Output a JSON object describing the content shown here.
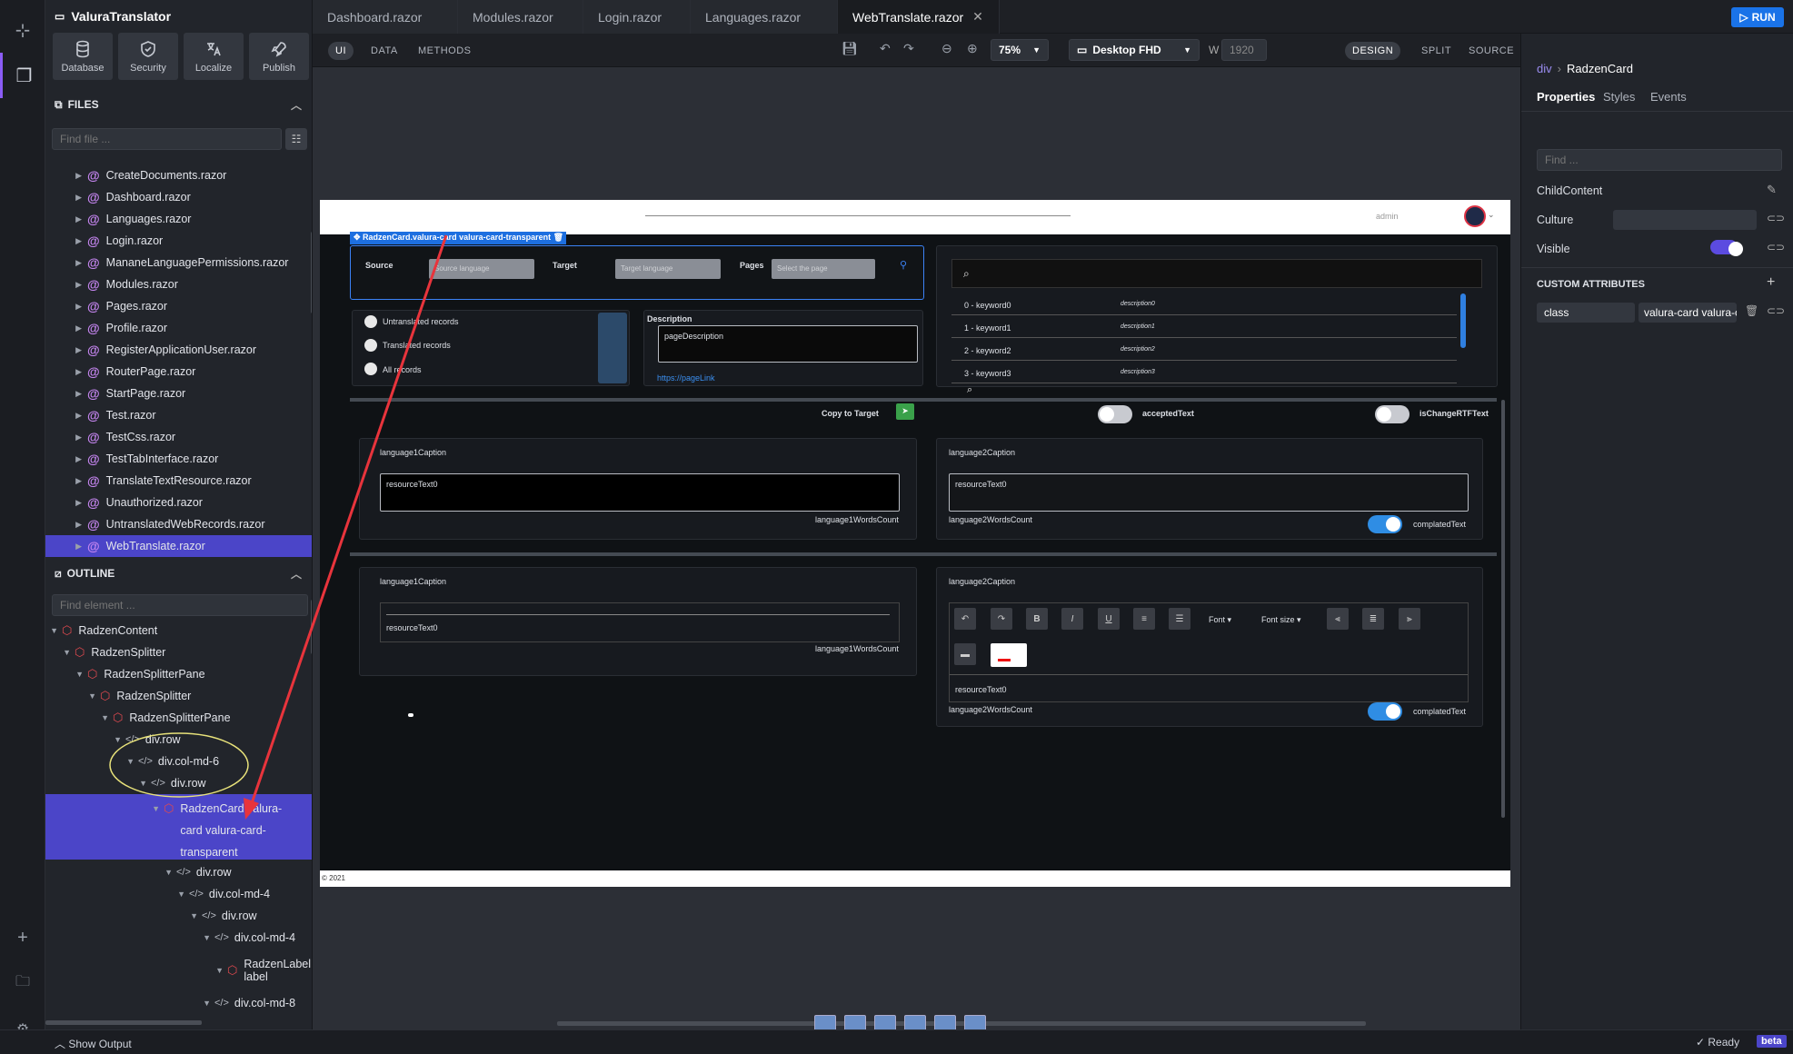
{
  "app": {
    "title": "ValuraTranslator"
  },
  "quick_actions": [
    {
      "label": "Database",
      "icon": "database-icon"
    },
    {
      "label": "Security",
      "icon": "shield-icon"
    },
    {
      "label": "Localize",
      "icon": "translate-icon"
    },
    {
      "label": "Publish",
      "icon": "rocket-icon"
    }
  ],
  "files": {
    "header": "FILES",
    "placeholder": "Find file ...",
    "items": [
      "CreateDocuments.razor",
      "Dashboard.razor",
      "Languages.razor",
      "Login.razor",
      "MananeLanguagePermissions.razor",
      "Modules.razor",
      "Pages.razor",
      "Profile.razor",
      "RegisterApplicationUser.razor",
      "RouterPage.razor",
      "StartPage.razor",
      "Test.razor",
      "TestCss.razor",
      "TestTabInterface.razor",
      "TranslateTextResource.razor",
      "Unauthorized.razor",
      "UntranslatedWebRecords.razor",
      "WebTranslate.razor"
    ],
    "selected": "WebTranslate.razor"
  },
  "outline": {
    "header": "OUTLINE",
    "placeholder": "Find element ...",
    "items": [
      {
        "label": "RadzenContent",
        "kind": "component"
      },
      {
        "label": "RadzenSplitter",
        "kind": "component"
      },
      {
        "label": "RadzenSplitterPane",
        "kind": "component"
      },
      {
        "label": "RadzenSplitter",
        "kind": "component"
      },
      {
        "label": "RadzenSplitterPane",
        "kind": "component"
      },
      {
        "label": "div.row",
        "kind": "element"
      },
      {
        "label": "div.col-md-6",
        "kind": "element"
      },
      {
        "label": "div.row",
        "kind": "element"
      },
      {
        "label": "RadzenCard.valura-card valura-card-transparent",
        "kind": "component"
      },
      {
        "label": "div.row",
        "kind": "element"
      },
      {
        "label": "div.col-md-4",
        "kind": "element"
      },
      {
        "label": "div.row",
        "kind": "element"
      },
      {
        "label": "div.col-md-4",
        "kind": "element"
      },
      {
        "label": "RadzenLabel label",
        "kind": "component"
      },
      {
        "label": "div.col-md-8",
        "kind": "element"
      }
    ]
  },
  "tabs": [
    "Dashboard.razor",
    "Modules.razor",
    "Login.razor",
    "Languages.razor",
    "WebTranslate.razor"
  ],
  "active_tab": "WebTranslate.razor",
  "run_label": "RUN",
  "toolbar": {
    "modes": [
      "UI",
      "DATA",
      "METHODS"
    ],
    "zoom": "75%",
    "device": "Desktop FHD",
    "width_label": "W",
    "width_value": "1920",
    "views": [
      "DESIGN",
      "SPLIT",
      "SOURCE"
    ]
  },
  "inspector": {
    "breadcrumb_root": "div",
    "breadcrumb_current": "RadzenCard",
    "tabs": [
      "Properties",
      "Styles",
      "Events"
    ],
    "find_placeholder": "Find ...",
    "props": [
      {
        "name": "ChildContent"
      },
      {
        "name": "Culture"
      },
      {
        "name": "Visible",
        "value": true
      }
    ],
    "custom_attrs_header": "CUSTOM ATTRIBUTES",
    "attr_name": "class",
    "attr_value": "valura-card valura-card-transparent"
  },
  "design": {
    "user": "admin",
    "selection_label": "RadzenCard.valura-card valura-card-transparent",
    "source_label": "Source",
    "source_placeholder": "Source language",
    "target_label": "Target",
    "target_placeholder": "Target language",
    "pages_label": "Pages",
    "pages_placeholder": "Select the page",
    "radios": [
      "Untranslated records",
      "Translated records",
      "All records"
    ],
    "description_label": "Description",
    "description_value": "pageDescription",
    "page_link": "https://pageLink",
    "keywords": [
      {
        "k": "0 - keyword0",
        "d": "description0"
      },
      {
        "k": "1 - keyword1",
        "d": "description1"
      },
      {
        "k": "2 - keyword2",
        "d": "description2"
      },
      {
        "k": "3 - keyword3",
        "d": "description3"
      }
    ],
    "copy_label": "Copy to Target",
    "accepted_label": "acceptedText",
    "rtf_label": "isChangeRTFText",
    "lang1_caption": "language1Caption",
    "lang2_caption": "language2Caption",
    "resource_text": "resourceText0",
    "lang1_count": "language1WordsCount",
    "lang2_count": "language2WordsCount",
    "completed_label": "complatedText",
    "font_label": "Font",
    "fontsize_label": "Font size",
    "footer": "© 2021"
  },
  "status": {
    "show_output": "Show Output",
    "ready": "Ready",
    "beta": "beta"
  },
  "colors": {
    "accent": "#4b45c8",
    "run": "#1a73e8",
    "annotation": "#e8343c",
    "highlight": "#e8e27a"
  }
}
